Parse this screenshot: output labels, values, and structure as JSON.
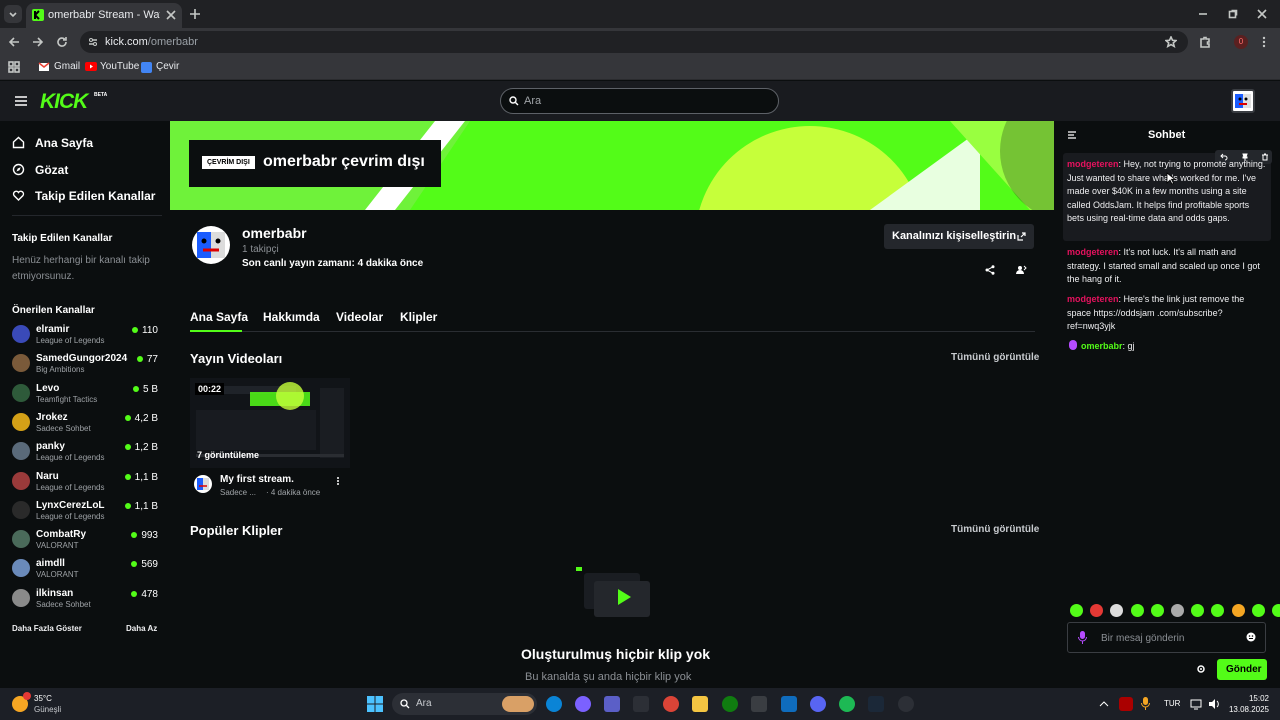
{
  "browser": {
    "tab_title": "omerbabr Stream - Watch Live",
    "url_host": "kick.com",
    "url_path": "/omerbabr",
    "bookmarks": [
      "Gmail",
      "YouTube",
      "Çevir"
    ],
    "ext_badge": "0"
  },
  "kick": {
    "logo": "KICK",
    "logo_badge": "BETA",
    "search_placeholder": "Ara",
    "nav": [
      "Ana Sayfa",
      "Gözat",
      "Takip Edilen Kanallar"
    ],
    "followed_title": "Takip Edilen Kanallar",
    "followed_empty": "Henüz herhangi bir kanalı takip etmiyorsunuz.",
    "recommended_title": "Önerilen Kanallar",
    "recommended": [
      {
        "name": "elramir",
        "category": "League of Legends",
        "viewers": "110",
        "color": "#3a4ab8"
      },
      {
        "name": "SamedGungor2024",
        "category": "Big Ambitions",
        "viewers": "77",
        "color": "#7a5a3a"
      },
      {
        "name": "Levo",
        "category": "Teamfight Tactics",
        "viewers": "5 B",
        "color": "#2e5a3a"
      },
      {
        "name": "Jrokez",
        "category": "Sadece Sohbet",
        "viewers": "4,2 B",
        "color": "#d4a017"
      },
      {
        "name": "panky",
        "category": "League of Legends",
        "viewers": "1,2 B",
        "color": "#5a6a7a"
      },
      {
        "name": "Naru",
        "category": "League of Legends",
        "viewers": "1,1 B",
        "color": "#9a3a3a"
      },
      {
        "name": "LynxCerezLoL",
        "category": "League of Legends",
        "viewers": "1,1 B",
        "color": "#2a2a2a"
      },
      {
        "name": "CombatRy",
        "category": "VALORANT",
        "viewers": "993",
        "color": "#4a6a5a"
      },
      {
        "name": "aimdll",
        "category": "VALORANT",
        "viewers": "569",
        "color": "#6a8aba"
      },
      {
        "name": "ilkinsan",
        "category": "Sadece Sohbet",
        "viewers": "478",
        "color": "#8a8a8a"
      }
    ],
    "show_more": "Daha Fazla Göster",
    "show_less": "Daha Az",
    "banner": {
      "offline_badge": "ÇEVRİM DIŞI",
      "offline_title": "omerbabr çevrim dışı"
    },
    "channel": {
      "name": "omerbabr",
      "followers": "1 takipçi",
      "last_live": "Son canlı yayın zamanı: 4 dakika önce",
      "customize_button": "Kanalınızı kişiselleştirin"
    },
    "tabs": [
      "Ana Sayfa",
      "Hakkımda",
      "Videolar",
      "Klipler"
    ],
    "videos_section": {
      "title": "Yayın Videoları",
      "see_all": "Tümünü görüntüle"
    },
    "video": {
      "duration": "00:22",
      "views": "7 görüntüleme",
      "title": "My first stream.",
      "category": "Sadece ...",
      "time": "· 4 dakika önce"
    },
    "clips_section": {
      "title": "Popüler Klipler",
      "see_all": "Tümünü görüntüle"
    },
    "clips_empty": {
      "title": "Oluşturulmuş hiçbir klip yok",
      "subtitle": "Bu kanalda şu anda hiçbir klip yok"
    },
    "chat": {
      "title": "Sohbet",
      "messages": [
        {
          "user": "modgeteren",
          "text": ": Hey, not trying to promote anything. Just wanted to share what's worked for me. I've made over $40K in a few months using a site called OddsJam. It helps find profitable sports bets using real-time data and odds gaps."
        },
        {
          "user": "modgeteren",
          "text": ": It's not luck. It's all math and strategy. I started small and scaled up once I got the hang of it."
        },
        {
          "user": "modgeteren",
          "text": ": Here's the link just remove the space https://oddsjam .com/subscribe?ref=nwq3yjk"
        },
        {
          "user": "omerbabr",
          "text": ": gj"
        }
      ],
      "input_placeholder": "Bir mesaj gönderin",
      "send_button": "Gönder"
    }
  },
  "taskbar": {
    "weather_temp": "35°C",
    "weather_desc": "Güneşli",
    "search_placeholder": "Ara",
    "lang": "TUR",
    "time": "15:02",
    "date": "13.08.2025"
  }
}
